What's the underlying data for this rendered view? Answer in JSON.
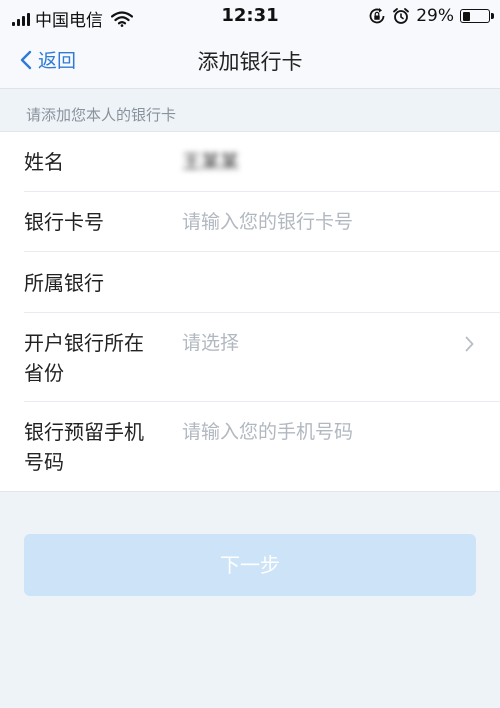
{
  "status_bar": {
    "carrier": "中国电信",
    "time": "12:31",
    "battery_percent": "29%",
    "battery_level": 0.29,
    "icons": [
      "signal-icon",
      "wifi-icon",
      "rotation-lock-icon",
      "alarm-icon",
      "battery-icon"
    ]
  },
  "nav": {
    "back_label": "返回",
    "title": "添加银行卡"
  },
  "form": {
    "section_hint": "请添加您本人的银行卡",
    "rows": [
      {
        "label_line1": "姓名",
        "value": "王某某",
        "value_obscured": true
      },
      {
        "label_line1": "银行卡号",
        "placeholder": "请输入您的银行卡号"
      },
      {
        "label_line1": "所属银行",
        "value": ""
      },
      {
        "label_line1": "开户银行所在",
        "label_line2": "省份",
        "placeholder": "请选择"
      },
      {
        "label_line1": "银行预留手机",
        "label_line2": "号码",
        "placeholder": "请输入您的手机号码"
      }
    ]
  },
  "next_button": {
    "label": "下一步",
    "state": "disabled",
    "color": "#cde3f8"
  },
  "colors": {
    "accent": "#2f7bd4",
    "background": "#eef3f8",
    "placeholder": "#b2b8c0"
  }
}
